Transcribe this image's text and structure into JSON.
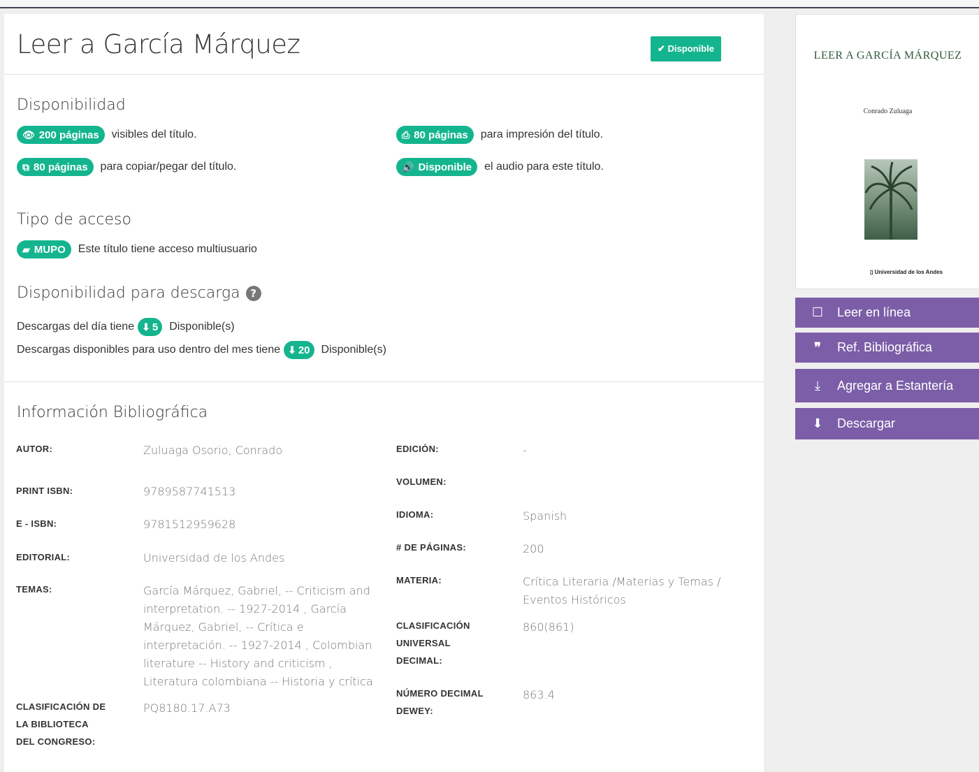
{
  "title": "Leer a García Márquez",
  "status_badge": "✔ Disponible",
  "availability": {
    "heading": "Disponibilidad",
    "visible_pill": "200 páginas",
    "visible_text": "visibles del título.",
    "print_pill": "80 páginas",
    "print_text": "para impresión del título.",
    "copy_pill": "80 páginas",
    "copy_text": "para copiar/pegar del título.",
    "audio_pill": "Disponible",
    "audio_text": "el audio para este título."
  },
  "access": {
    "heading": "Tipo de acceso",
    "pill": "MUPO",
    "text": "Este título tiene acceso multiusuario"
  },
  "download": {
    "heading": "Disponibilidad para descarga",
    "help": "?",
    "day_text": "Descargas del día tiene",
    "day_count": "5",
    "day_suffix": "Disponible(s)",
    "month_text": "Descargas disponibles para uso dentro del mes tiene",
    "month_count": "20",
    "month_suffix": "Disponible(s)"
  },
  "biblio": {
    "heading": "Información Bibliográfica",
    "autor_label": "AUTOR:",
    "autor": "Zuluaga Osorio, Conrado",
    "print_isbn_label": "PRINT ISBN:",
    "print_isbn": "9789587741513",
    "eisbn_label": "E - ISBN:",
    "eisbn": "9781512959628",
    "editorial_label": "EDITORIAL:",
    "editorial": "Universidad de los Andes",
    "temas_label": "TEMAS:",
    "temas": [
      "García Márquez, Gabriel, -- Criticism and",
      "interpretation. -- 1927-2014 , García",
      "Márquez, Gabriel, -- Crítica e",
      "interpretación. -- 1927-2014 , Colombian",
      "literature -- History and criticism ,",
      "Literatura colombiana -- Historia y crítica"
    ],
    "lc_label": [
      "CLASIFICACIÓN DE",
      "LA BIBLIOTECA",
      "DEL CONGRESO:"
    ],
    "lc": "PQ8180.17.A73",
    "edicion_label": "EDICIÓN:",
    "edicion": "-",
    "volumen_label": "VOLUMEN:",
    "idioma_label": "IDIOMA:",
    "idioma": "Spanish",
    "paginas_label": "# DE PÁGINAS:",
    "paginas": "200",
    "materia_label": "MATERIA:",
    "materia": [
      "Crítica Literaria /Materias y Temas /",
      "Eventos Históricos"
    ],
    "cud_label": [
      "CLASIFICACIÓN",
      "UNIVERSAL",
      "DECIMAL:"
    ],
    "cud": "860(861)",
    "dewey_label": [
      "NÚMERO DECIMAL",
      "DEWEY:"
    ],
    "dewey": "863.4"
  },
  "cover": {
    "title": "LEER A GARCÍA MÁRQUEZ",
    "author": "Conrado Zuluaga",
    "publisher": "Universidad de los Andes"
  },
  "actions": {
    "read": "Leer en línea",
    "ref": "Ref. Bibliográfica",
    "shelf": "Agregar a Estantería",
    "download": "Descargar"
  },
  "icons": {
    "eye": "eye-icon",
    "print": "print-icon",
    "copy": "copy-icon",
    "audio": "volume-icon",
    "book": "book-icon",
    "download": "download-icon",
    "help": "question-icon",
    "tablet": "tablet-icon",
    "quote": "quote-icon",
    "inbox": "inbox-download-icon"
  },
  "colors": {
    "accent_green": "#14b58e",
    "action_purple": "#7b5ea7"
  }
}
